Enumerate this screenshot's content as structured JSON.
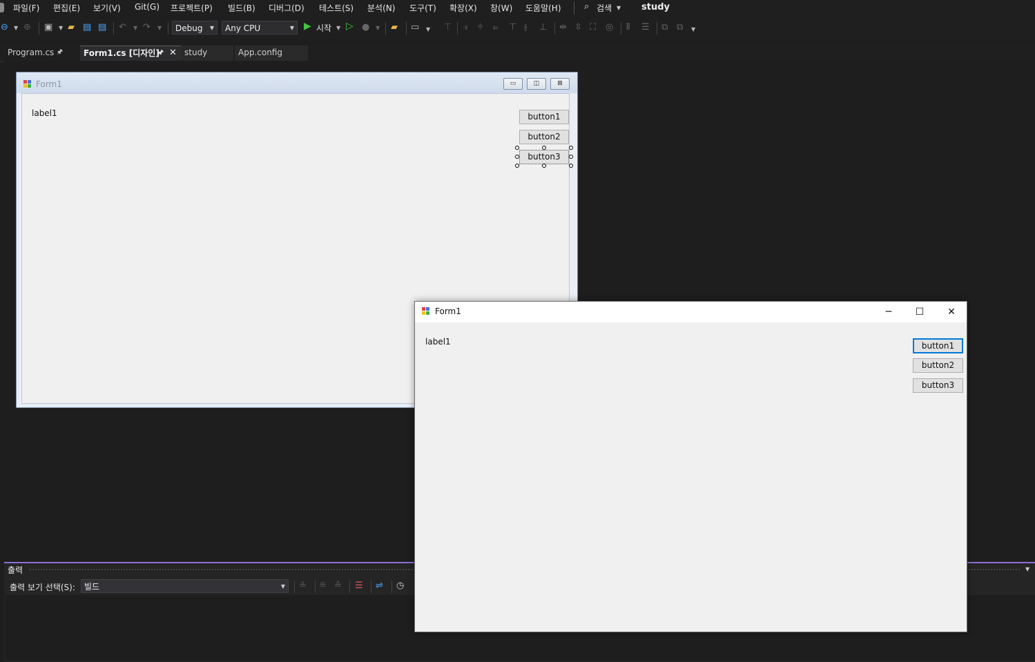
{
  "menu": {
    "items": [
      "파일(F)",
      "편집(E)",
      "보기(V)",
      "Git(G)",
      "프로젝트(P)",
      "빌드(B)",
      "디버그(D)",
      "테스트(S)",
      "분석(N)",
      "도구(T)",
      "확장(X)",
      "창(W)",
      "도움말(H)"
    ],
    "search": "검색",
    "solution": "study"
  },
  "toolbar": {
    "config": "Debug",
    "platform": "Any CPU",
    "start_label": "시작"
  },
  "tabs": [
    {
      "label": "Program.cs",
      "pin": "🖈"
    },
    {
      "label": "Form1.cs [디자인]",
      "pin": "🖈"
    },
    {
      "label": "study"
    },
    {
      "label": "App.config"
    }
  ],
  "design_form": {
    "title": "Form1",
    "label": "label1",
    "buttons": [
      "button1",
      "button2",
      "button3"
    ],
    "selected": "button3"
  },
  "runtime_form": {
    "title": "Form1",
    "label": "label1",
    "buttons": [
      "button1",
      "button2",
      "button3"
    ],
    "focused": "button1"
  },
  "output": {
    "title": "출력",
    "source_label": "출력 보기 선택(S):",
    "source_value": "빌드"
  },
  "colors": {
    "accent": "#8f6fd6",
    "focus": "#0078d7",
    "ide_bg": "#1e1e1f"
  }
}
